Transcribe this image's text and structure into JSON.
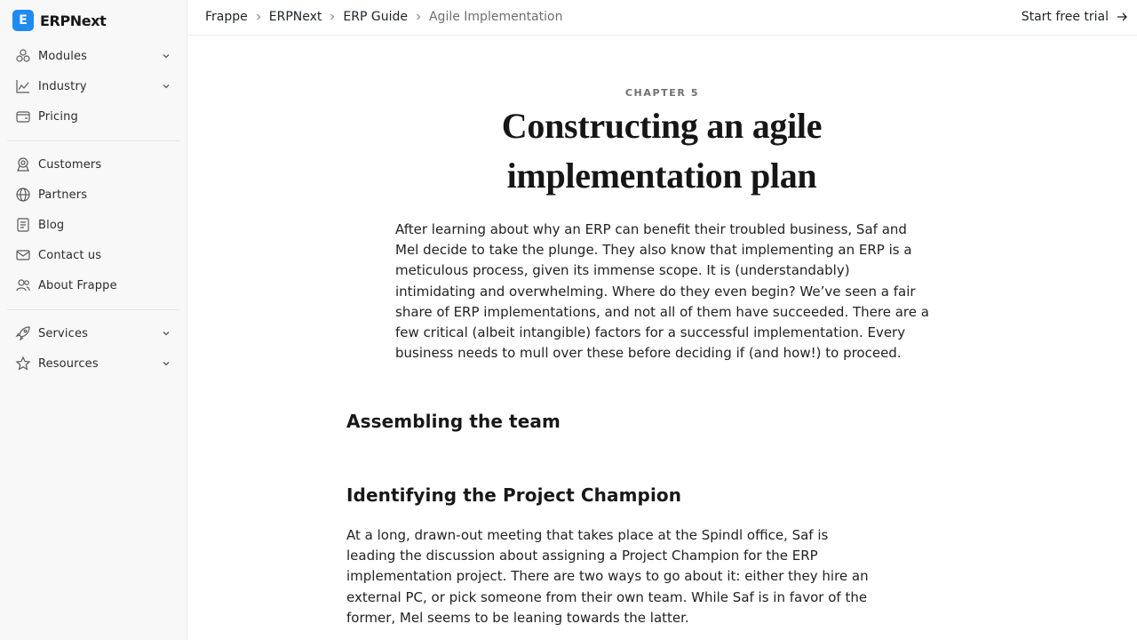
{
  "brand": {
    "name": "ERPNext",
    "mark": "E",
    "accent": "#1f8bf0"
  },
  "sidebar": {
    "items": [
      {
        "label": "Modules",
        "icon": "modules-icon",
        "has_submenu": true
      },
      {
        "label": "Industry",
        "icon": "industry-chart-icon",
        "has_submenu": true
      },
      {
        "label": "Pricing",
        "icon": "wallet-icon",
        "has_submenu": false
      },
      {
        "label": "Customers",
        "icon": "award-icon",
        "has_submenu": false
      },
      {
        "label": "Partners",
        "icon": "globe-icon",
        "has_submenu": false
      },
      {
        "label": "Blog",
        "icon": "notebook-icon",
        "has_submenu": false
      },
      {
        "label": "Contact us",
        "icon": "mail-icon",
        "has_submenu": false
      },
      {
        "label": "About Frappe",
        "icon": "users-icon",
        "has_submenu": false
      },
      {
        "label": "Services",
        "icon": "rocket-icon",
        "has_submenu": true
      },
      {
        "label": "Resources",
        "icon": "star-icon",
        "has_submenu": true
      }
    ]
  },
  "header": {
    "breadcrumbs": [
      "Frappe",
      "ERPNext",
      "ERP Guide",
      "Agile Implementation"
    ],
    "cta_label": "Start free trial"
  },
  "article": {
    "chapter": "CHAPTER 5",
    "title": "Constructing an agile implementation plan",
    "intro": "After learning about why an ERP can benefit their troubled business, Saf and Mel decide to take the plunge. They also know that implementing an ERP is a meticulous process, given its immense scope. It is (understandably) intimidating and overwhelming. Where do they even begin? We’ve seen a fair share of ERP implementations, and not all of them have succeeded. There are a few critical (albeit intangible) factors for a successful implementation. Every business needs to mull over these before deciding if (and how!) to proceed.",
    "section_1_heading": "Assembling the team",
    "section_2_heading": "Identifying the Project Champion",
    "section_2_body": "At a long, drawn-out meeting that takes place at the Spindl office, Saf is leading the discussion about assigning a Project Champion for the ERP implementation project. There are two ways to go about it: either they hire an external PC, or pick someone from their own team. While Saf is in favor of the former, Mel seems to be leaning towards the latter."
  }
}
